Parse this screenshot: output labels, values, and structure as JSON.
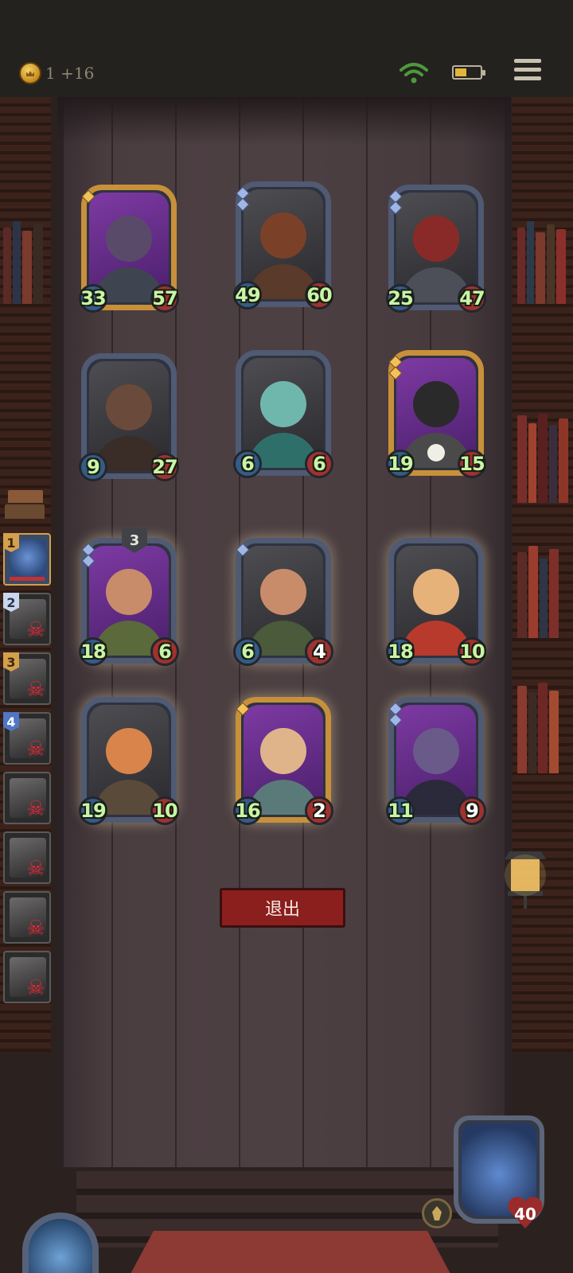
{
  "status_bar": {
    "gold_text": "1 +16",
    "icons": [
      "coin-icon",
      "wifi-icon",
      "battery-icon",
      "menu-icon"
    ],
    "battery_level": 0.45
  },
  "board": {
    "cards": [
      {
        "id": "sphynx-cat",
        "frame": "gold",
        "attack": "33",
        "health": "57",
        "tier_gems": 1
      },
      {
        "id": "ogre",
        "frame": "silver",
        "attack": "49",
        "health": "60",
        "tier_gems": 2
      },
      {
        "id": "armored-knight",
        "frame": "silver",
        "attack": "25",
        "health": "47",
        "tier_gems": 2
      },
      {
        "id": "bald-brute",
        "frame": "silver",
        "attack": "9",
        "health": "27",
        "tier_gems": 0
      },
      {
        "id": "crystal-golem",
        "frame": "silver",
        "attack": "6",
        "health": "6",
        "tier_gems": 0
      },
      {
        "id": "mech-bot",
        "frame": "gold",
        "attack": "19",
        "health": "15",
        "tier_gems": 2
      },
      {
        "id": "bandit-elite",
        "frame": "silver",
        "attack": "18",
        "health": "6",
        "tier_gems": 2,
        "level_badge": "3"
      },
      {
        "id": "bandit",
        "frame": "silver",
        "attack": "6",
        "health": "4",
        "tier_gems": 1
      },
      {
        "id": "red-scarf-brawler",
        "frame": "silver",
        "attack": "18",
        "health": "10",
        "tier_gems": 0
      },
      {
        "id": "archer",
        "frame": "silver",
        "attack": "19",
        "health": "10",
        "tier_gems": 0
      },
      {
        "id": "shield-soldier",
        "frame": "gold",
        "attack": "16",
        "health": "2",
        "tier_gems": 1
      },
      {
        "id": "octopus-pirate",
        "frame": "silver",
        "attack": "11",
        "health": "9",
        "tier_gems": 2
      }
    ]
  },
  "exit_button": {
    "label": "退出"
  },
  "roster": [
    {
      "rank": "1",
      "style": "gold",
      "status": "alive"
    },
    {
      "rank": "2",
      "style": "silver",
      "status": "dead"
    },
    {
      "rank": "3",
      "style": "gold",
      "status": "dead"
    },
    {
      "rank": "4",
      "style": "blue",
      "status": "dead"
    },
    {
      "rank": "",
      "style": "none",
      "status": "dead"
    },
    {
      "rank": "",
      "style": "none",
      "status": "dead"
    },
    {
      "rank": "",
      "style": "none",
      "status": "dead"
    },
    {
      "rank": "",
      "style": "none",
      "status": "dead"
    }
  ],
  "hero": {
    "health": "40"
  },
  "colors": {
    "gold_frame": "#c8903a",
    "silver_frame": "#505a72",
    "attack_orb": "#345c86",
    "health_orb": "#a0322f",
    "stat_text": "#c7f5a6",
    "exit_button": "#8a1f1e",
    "dead_mark": "#e02a37"
  }
}
